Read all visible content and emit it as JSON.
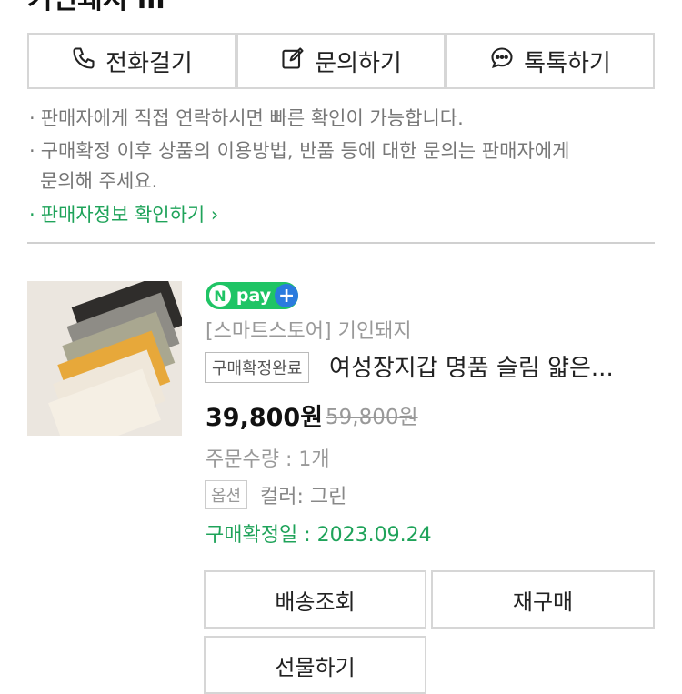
{
  "header": {
    "title_cut": "기인돼지 lll",
    "right_cut": "ᆞ ᆞ ᆞ"
  },
  "contact_buttons": [
    {
      "label": "전화걸기",
      "icon": "phone-icon"
    },
    {
      "label": "문의하기",
      "icon": "edit-icon"
    },
    {
      "label": "톡톡하기",
      "icon": "chat-bubble-icon"
    }
  ],
  "notes": {
    "line1": "판매자에게 직접 연락하시면 빠른 확인이 가능합니다.",
    "line2a": "구매확정 이후 상품의 이용방법, 반품 등에 대한 문의는 판매자에게",
    "line2b": "문의해 주세요.",
    "seller_info_link": "판매자정보 확인하기"
  },
  "order": {
    "npay": {
      "n": "N",
      "pay": "pay",
      "plus": "+"
    },
    "store": "[스마트스토어] 기인돼지",
    "status_badge": "구매확정완료",
    "product_title": "여성장지갑 명품 슬림 얇은...",
    "price": "39,800원",
    "original_price": "59,800원",
    "quantity": "주문수량 : 1개",
    "option_badge": "옵션",
    "option_value": "컬러: 그린",
    "confirm_date": "구매확정일 : 2023.09.24"
  },
  "action_buttons": {
    "shipping": "배송조회",
    "rebuy": "재구매",
    "gift": "선물하기"
  },
  "colors": {
    "accent_green": "#1fa35a",
    "npay_green": "#1fc465",
    "border": "#d6d6d6"
  }
}
